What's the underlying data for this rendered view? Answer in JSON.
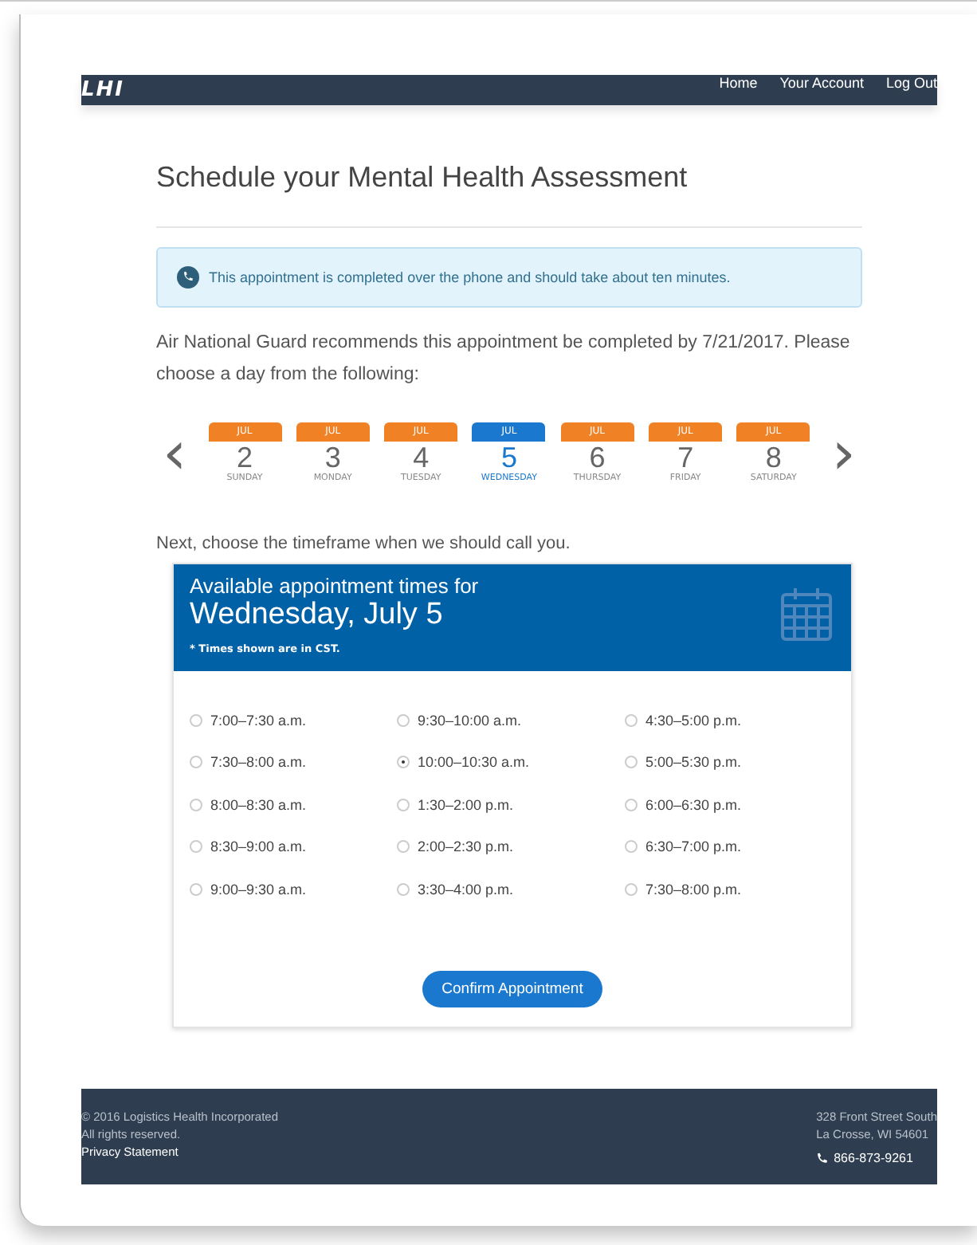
{
  "header": {
    "logo": "LHI",
    "nav": [
      {
        "label": "Home"
      },
      {
        "label": "Your Account"
      },
      {
        "label": "Log Out"
      }
    ]
  },
  "title": "Schedule your Mental Health Assessment",
  "notice": "This appointment is completed over the phone and should take about ten minutes.",
  "instructions": "Air National Guard recommends this appointment be completed by 7/21/2017. Please choose a day from the following:",
  "prev_arrow": "‹",
  "next_arrow": "›",
  "days": [
    {
      "month": "JUL",
      "day": "2",
      "weekday": "SUNDAY",
      "selected": false
    },
    {
      "month": "JUL",
      "day": "3",
      "weekday": "MONDAY",
      "selected": false
    },
    {
      "month": "JUL",
      "day": "4",
      "weekday": "TUESDAY",
      "selected": false
    },
    {
      "month": "JUL",
      "day": "5",
      "weekday": "WEDNESDAY",
      "selected": true
    },
    {
      "month": "JUL",
      "day": "6",
      "weekday": "THURSDAY",
      "selected": false
    },
    {
      "month": "JUL",
      "day": "7",
      "weekday": "FRIDAY",
      "selected": false
    },
    {
      "month": "JUL",
      "day": "8",
      "weekday": "SATURDAY",
      "selected": false
    }
  ],
  "timeframe_prompt": "Next, choose the timeframe when we should call you.",
  "panel": {
    "heading": "Available appointment times for",
    "date": "Wednesday, July 5",
    "note": "* Times shown are in CST."
  },
  "time_slots": [
    {
      "label": "7:00–7:30 a.m.",
      "selected": false
    },
    {
      "label": "7:30–8:00 a.m.",
      "selected": false
    },
    {
      "label": "8:00–8:30 a.m.",
      "selected": false
    },
    {
      "label": "8:30–9:00 a.m.",
      "selected": false
    },
    {
      "label": "9:00–9:30 a.m.",
      "selected": false
    },
    {
      "label": "9:30–10:00 a.m.",
      "selected": false
    },
    {
      "label": "10:00–10:30 a.m.",
      "selected": true
    },
    {
      "label": "1:30–2:00 p.m.",
      "selected": false
    },
    {
      "label": "2:00–2:30 p.m.",
      "selected": false
    },
    {
      "label": "3:30–4:00 p.m.",
      "selected": false
    },
    {
      "label": "4:30–5:00 p.m.",
      "selected": false
    },
    {
      "label": "5:00–5:30 p.m.",
      "selected": false
    },
    {
      "label": "6:00–6:30 p.m.",
      "selected": false
    },
    {
      "label": "6:30–7:00 p.m.",
      "selected": false
    },
    {
      "label": "7:30–8:00 p.m.",
      "selected": false
    }
  ],
  "confirm_button": "Confirm Appointment",
  "footer": {
    "copyright": "© 2016 Logistics Health Incorporated",
    "rights": "All rights reserved.",
    "privacy_link": "Privacy Statement",
    "address_line_1": "328 Front Street South",
    "address_line_2": "La Crosse, WI 54601",
    "phone": "866-873-9261"
  }
}
